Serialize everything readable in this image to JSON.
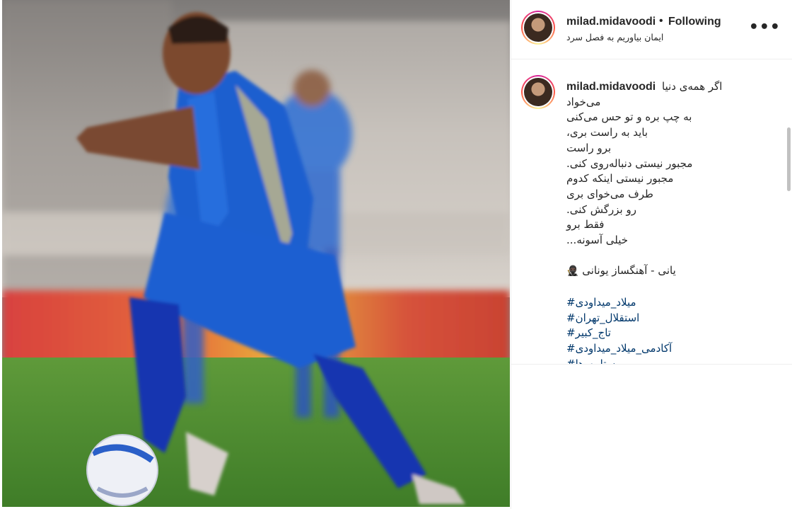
{
  "header": {
    "username": "milad.midavoodi",
    "dot": "•",
    "follow_state": "Following",
    "location": "ایمان بیاوریم به فصل سرد",
    "more_icon": "more-horizontal-icon",
    "more_label": "•••"
  },
  "post": {
    "username": "milad.midavoodi",
    "caption_first": "اگر همه‌ی دنیا",
    "caption_lines": [
      "می‌خواد",
      "به چپ بره و تو حس می‌کنی",
      "،باید به راست بری",
      "برو راست",
      ".مجبور نیستی دنباله‌روی کنی",
      "مجبور نیستی اینکه کدوم",
      "طرف می‌خوای بری",
      ".رو بزرگش کنی",
      "فقط برو",
      "...خیلی آسونه"
    ],
    "credit": "یانی - آهنگساز یونانی",
    "credit_emoji": "🥷🏿",
    "hashtags": [
      "#میلاد_میداودی",
      "#استقلال_تهران",
      "#تاج_کبیر",
      "#آکادمی_میلاد_میداودی",
      "#ستاره_ها"
    ]
  },
  "colors": {
    "accent_link": "#00376b",
    "text": "#262626",
    "border": "#efefef"
  },
  "photo_icon": "football-player-photo"
}
